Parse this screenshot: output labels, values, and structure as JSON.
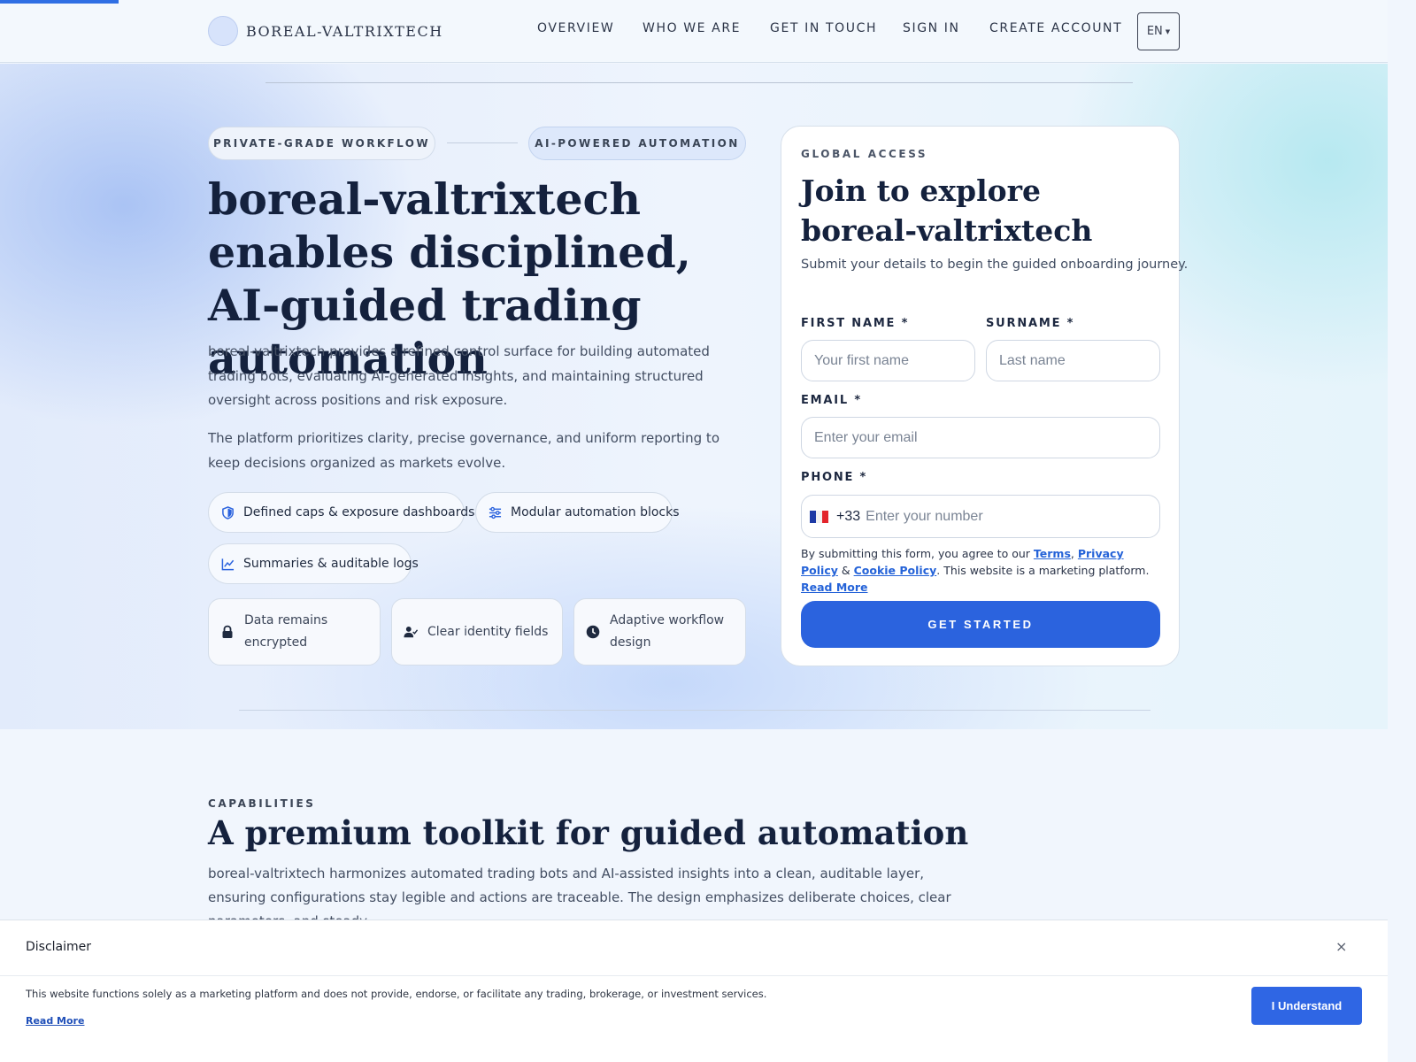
{
  "brand": {
    "name": "BOREAL-VALTRIXTECH"
  },
  "nav": {
    "items": [
      "OVERVIEW",
      "WHO WE ARE",
      "GET IN TOUCH",
      "SIGN IN",
      "CREATE ACCOUNT"
    ],
    "language": "EN"
  },
  "hero": {
    "tags": [
      "PRIVATE-GRADE WORKFLOW",
      "AI-POWERED AUTOMATION"
    ],
    "title": "boreal-valtrixtech enables disciplined, AI-guided trading automation",
    "paragraph1": "boreal-valtrixtech provides a refined control surface for building automated trading bots, evaluating AI-generated insights, and maintaining structured oversight across positions and risk exposure.",
    "paragraph2": "The platform prioritizes clarity, precise governance, and uniform reporting to keep decisions organized as markets evolve.",
    "features": [
      {
        "label": "Defined caps & exposure dashboards",
        "icon": "shield-icon"
      },
      {
        "label": "Modular automation blocks",
        "icon": "sliders-icon"
      },
      {
        "label": "Summaries & auditable logs",
        "icon": "chart-line-icon"
      }
    ],
    "cards": [
      {
        "label": "Data remains encrypted",
        "icon": "lock-icon"
      },
      {
        "label": "Clear identity fields",
        "icon": "user-check-icon"
      },
      {
        "label": "Adaptive workflow design",
        "icon": "clock-icon"
      }
    ]
  },
  "form": {
    "eyebrow": "GLOBAL ACCESS",
    "title": "Join to explore boreal-valtrixtech",
    "subtitle": "Submit your details to begin the guided onboarding journey.",
    "first_name_label": "FIRST NAME *",
    "first_name_placeholder": "Your first name",
    "surname_label": "SURNAME *",
    "surname_placeholder": "Last name",
    "email_label": "EMAIL *",
    "email_placeholder": "Enter your email",
    "phone_label": "PHONE *",
    "phone_dial": "+33",
    "phone_placeholder": "Enter your number",
    "consent_prefix": "By submitting this form, you agree to our ",
    "terms": "Terms",
    "sep1": ", ",
    "privacy": "Privacy Policy",
    "sep2": " & ",
    "cookie": "Cookie Policy",
    "consent_suffix": ". This website is a marketing platform. ",
    "read_more": "Read More",
    "submit": "GET STARTED"
  },
  "capabilities": {
    "eyebrow": "CAPABILITIES",
    "title": "A premium toolkit for guided automation",
    "paragraph": "boreal-valtrixtech harmonizes automated trading bots and AI-assisted insights into a clean, auditable layer, ensuring configurations stay legible and actions are traceable. The design emphasizes deliberate choices, clear parameters, and steady"
  },
  "disclaimer": {
    "title": "Disclaimer",
    "close": "×",
    "text": "This website functions solely as a marketing platform and does not provide, endorse, or facilitate any trading, brokerage, or investment services.",
    "link": "Read More",
    "button": "I Understand"
  },
  "colors": {
    "accent": "#2b63de",
    "ink": "#14213d",
    "link": "#2563d8"
  }
}
